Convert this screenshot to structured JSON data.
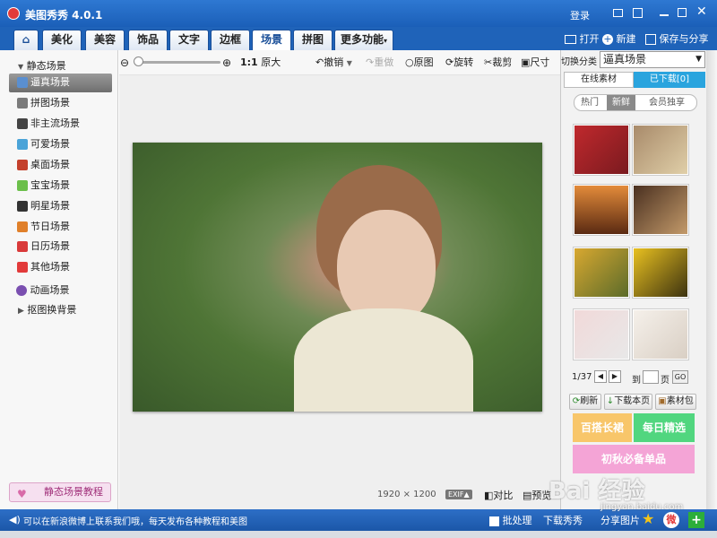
{
  "app": {
    "title": "美图秀秀 4.0.1",
    "login": "登录"
  },
  "tabs": [
    "美化",
    "美容",
    "饰品",
    "文字",
    "边框",
    "场景",
    "拼图"
  ],
  "more_tab": "更多功能",
  "header_actions": {
    "open": "打开",
    "new": "新建",
    "save": "保存与分享"
  },
  "toolbar": {
    "size_label": "1:1",
    "size_text": "原大",
    "undo": "撤销",
    "redo": "重做",
    "original": "原图",
    "rotate": "旋转",
    "crop": "裁剪",
    "resize": "尺寸"
  },
  "sidebar": {
    "static_group": "静态场景",
    "items": [
      "逼真场景",
      "拼图场景",
      "非主流场景",
      "可爱场景",
      "桌面场景",
      "宝宝场景",
      "明星场景",
      "节日场景",
      "日历场景",
      "其他场景"
    ],
    "animated_group": "动画场景",
    "cutout_group": "抠图换背景",
    "tutorial": "静态场景教程"
  },
  "right": {
    "switch_label": "切换分类",
    "category_value": "逼真场景",
    "tab_online": "在线素材",
    "tab_downloaded": "已下载[0]",
    "filters": [
      "热门",
      "新鲜",
      "会员独享"
    ],
    "page": "1/37",
    "goto_label": "到",
    "page_suffix": "页",
    "go": "GO",
    "refresh": "刷新",
    "download_page": "下载本页",
    "package": "素材包",
    "promo1": "百搭长裙",
    "promo2": "每日精选",
    "promo3": "初秋必备单品"
  },
  "image_info": {
    "dimensions": "1920 × 1200",
    "exif": "EXIF",
    "compare": "对比",
    "preview": "预览"
  },
  "status": {
    "message": "可以在新浪微博上联系我们哦，每天发布各种教程和美图",
    "batch": "批处理",
    "download": "下载秀秀",
    "share": "分享图片"
  },
  "watermark": "Bai 经验",
  "watermark_url": "jingyan.baidu.com",
  "colors": {
    "accent": "#1f63b9",
    "active_tab": "#1a4f98",
    "promo1": "#f8c66a",
    "promo2": "#51d67f",
    "promo3": "#f4a4d6"
  }
}
